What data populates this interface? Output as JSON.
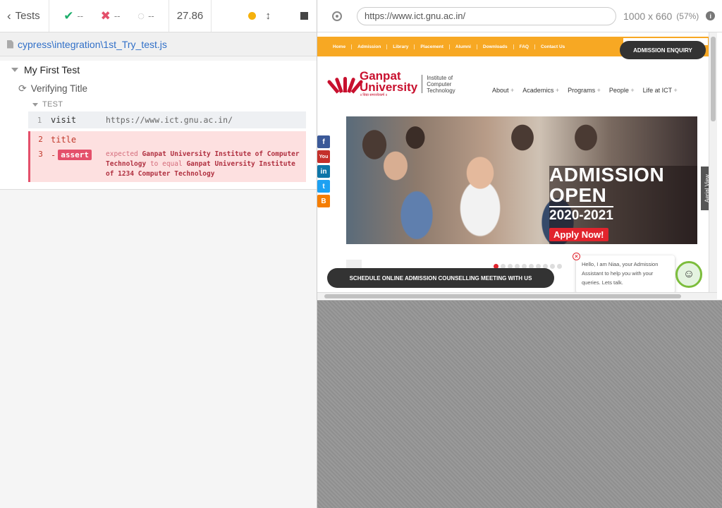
{
  "reporter": {
    "back_label": "Tests",
    "passed": "--",
    "failed": "--",
    "pending": "--",
    "duration": "27.86",
    "spec_path": "cypress\\integration\\1st_Try_test.js",
    "suite_title": "My First Test",
    "test_title": "Verifying Title",
    "section_label": "TEST",
    "commands": [
      {
        "num": "1",
        "name": "visit",
        "message": "https://www.ict.gnu.ac.in/"
      },
      {
        "num": "2",
        "name": "title",
        "message": ""
      },
      {
        "num": "3",
        "name": "-",
        "badge": "assert",
        "expected_word": "expected",
        "expected_value": "Ganpat University Institute of Computer Technology",
        "to_equal": "to equal",
        "actual_value": "Ganpat University Institute of 1234 Computer Technology"
      }
    ]
  },
  "aut": {
    "url": "https://www.ict.gnu.ac.in/",
    "viewport_size": "1000 x 660",
    "scale": "(57%)",
    "site": {
      "nav": [
        "Home",
        "Admission",
        "Library",
        "Placement",
        "Alumni",
        "Downloads",
        "FAQ",
        "Contact Us"
      ],
      "enquiry_button": "ADMISSION ENQUIRY",
      "logo_name_1": "Ganpat",
      "logo_name_2": "University",
      "logo_tagline": "॥ विद्या समाजोत्कर्ष ॥",
      "logo_inst_1": "Institute of",
      "logo_inst_2": "Computer",
      "logo_inst_3": "Technology",
      "menu": [
        "About",
        "Academics",
        "Programs",
        "People",
        "Life at ICT"
      ],
      "banner_line1": "ADMISSION",
      "banner_line2": "OPEN",
      "banner_year": "2020-2021",
      "banner_cta": "Apply Now!",
      "aerial_view": "Aerial View",
      "schedule_button": "SCHEDULE ONLINE ADMISSION COUNSELLING MEETING WITH US",
      "chat_text": "Hello, I am Niaa, your Admission Assistant to help you with your queries. Lets talk.",
      "carousel_dots": 10
    }
  },
  "colors": {
    "pass": "#1dae6b",
    "fail": "#e4506b",
    "running": "#f5b10c",
    "site_orange": "#f7a823",
    "site_red": "#c8102e"
  },
  "icons": {
    "back": "chevron-left-icon",
    "passed": "check-icon",
    "failed": "x-icon",
    "pending": "circle-notch-icon",
    "running": "dot-icon",
    "viewport_toggle": "arrows-vertical-icon",
    "stop": "stop-icon",
    "selector_playground": "crosshair-icon",
    "info": "info-icon"
  }
}
